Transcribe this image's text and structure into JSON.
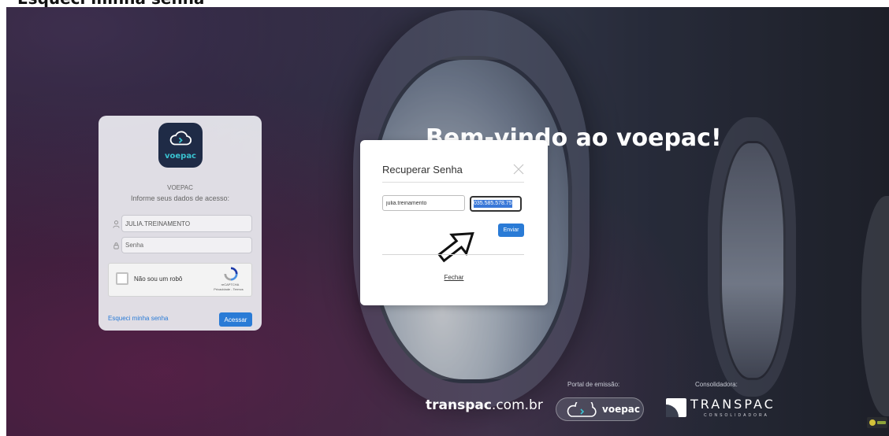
{
  "top_caption": "Esqueci minha senha",
  "welcome_title": "Bem-vindo ao voepac!",
  "login": {
    "logo_text": "voepac",
    "brand": "VOEPAC",
    "instructions": "Informe seus dados de acesso:",
    "username_value": "JULIA.TREINAMENTO",
    "password_placeholder": "Senha",
    "captcha": {
      "label": "Não sou um robô",
      "brand": "reCAPTCHA",
      "links": "Privacidade - Termos"
    },
    "forgot_link": "Esqueci minha senha",
    "submit_label": "Acessar"
  },
  "modal": {
    "title": "Recuperar Senha",
    "login_value": "julia.treinamento",
    "cpf_value": "035.585.578.75",
    "send_label": "Enviar",
    "close_label": "Fechar"
  },
  "footer": {
    "site_bold": "transpac",
    "site_rest": ".com.br",
    "portal_label": "Portal de emissão:",
    "portal_logo": "voepac",
    "consolidator_label": "Consolidadora:",
    "consolidator_name": "TRANSPAC",
    "consolidator_sub": "CONSOLIDADORA"
  },
  "icons": {
    "logo": "cloud-icon",
    "username": "user-icon",
    "password": "lock-icon",
    "close": "close-icon",
    "captcha": "recaptcha-icon",
    "annotation": "arrow-icon"
  },
  "colors": {
    "accent": "#2a7bd6",
    "logo_bg": "#1f2b46",
    "logo_teal": "#39c2d0",
    "selection": "#3a78d8"
  }
}
